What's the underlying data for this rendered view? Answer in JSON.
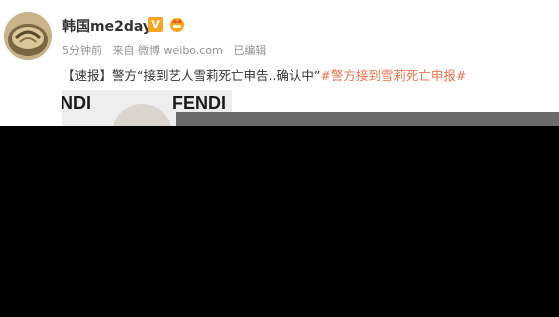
{
  "user": {
    "name": "韩国me2day",
    "vip_badge": "V",
    "avatar_icon": "avatar-image",
    "crown_icon": "crown-icon"
  },
  "meta": {
    "time": "5分钟前",
    "source": "来自 微博 weibo.com",
    "edited": "已编辑"
  },
  "post": {
    "prefix": "【速报】警方“接到艺人雪莉死亡申告..确认中”",
    "hashtag": "#警方接到雪莉死亡申报#"
  },
  "photo": {
    "brand_left": "NDI",
    "brand_right": "FENDI"
  },
  "colors": {
    "hashtag": "#eb7350",
    "vip_badge": "#f6a623",
    "meta_text": "#939393"
  }
}
